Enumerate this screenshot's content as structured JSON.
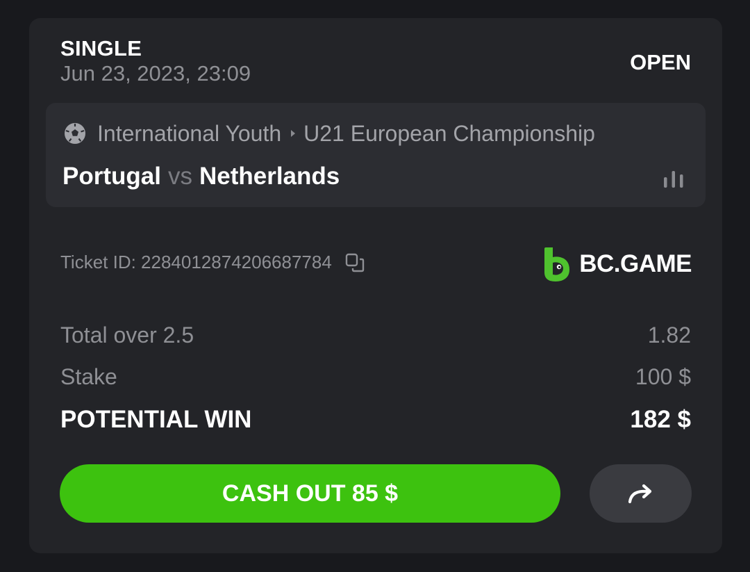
{
  "bet": {
    "type": "SINGLE",
    "date": "Jun 23, 2023, 23:09",
    "status": "OPEN"
  },
  "event": {
    "sport_icon": "soccer-ball-icon",
    "category": "International Youth",
    "league": "U21 European Championship",
    "home_team": "Portugal",
    "vs": "vs",
    "away_team": "Netherlands"
  },
  "ticket": {
    "label": "Ticket ID: 2284012874206687784"
  },
  "brand": {
    "name": "BC.GAME",
    "color": "#4fc22e"
  },
  "lines": {
    "market_label": "Total over 2.5",
    "market_value": "1.82",
    "stake_label": "Stake",
    "stake_value": "100 $",
    "win_label": "POTENTIAL WIN",
    "win_value": "182 $"
  },
  "actions": {
    "cashout_label": "CASH OUT 85 $",
    "cashout_color": "#3dc20f",
    "share_icon": "share-arrow-icon"
  }
}
